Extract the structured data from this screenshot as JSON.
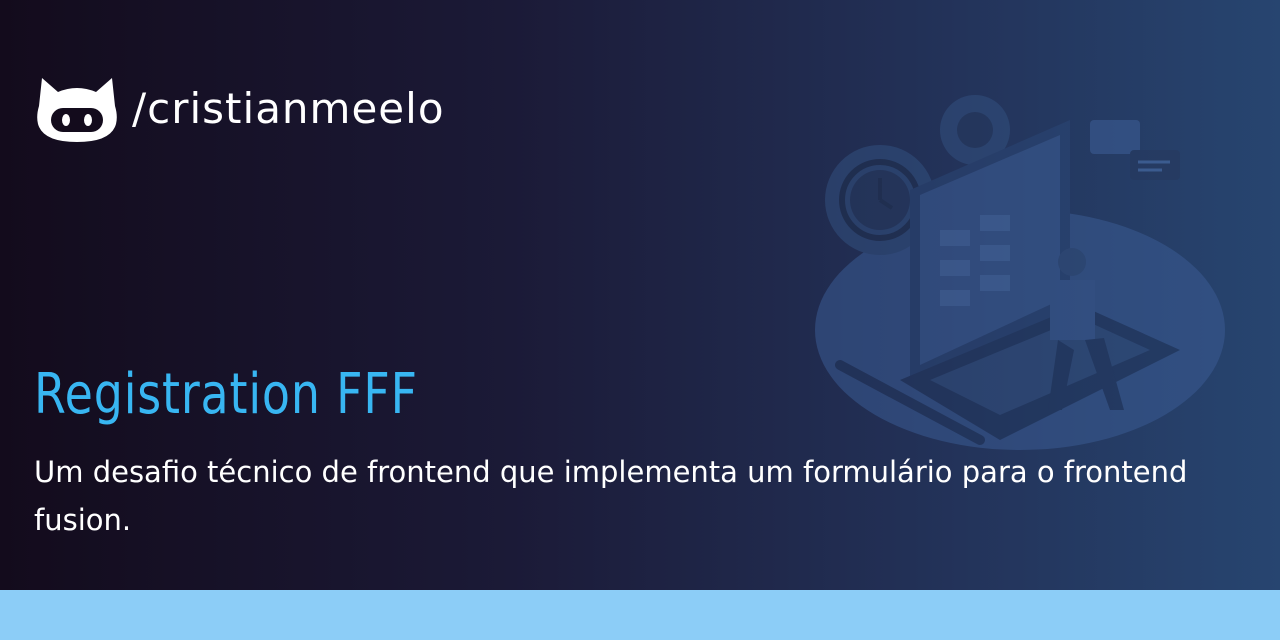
{
  "header": {
    "username": "/cristianmeelo",
    "logo_icon": "github-octocat-icon"
  },
  "title": "Registration FFF",
  "description": "Um desafio técnico de frontend que implementa um formulário para o frontend fusion.",
  "illustration_icon": "developer-laptop-illustration",
  "colors": {
    "title": "#38b6f2",
    "bottom_bar": "#8ccdf7",
    "text": "#ffffff"
  }
}
